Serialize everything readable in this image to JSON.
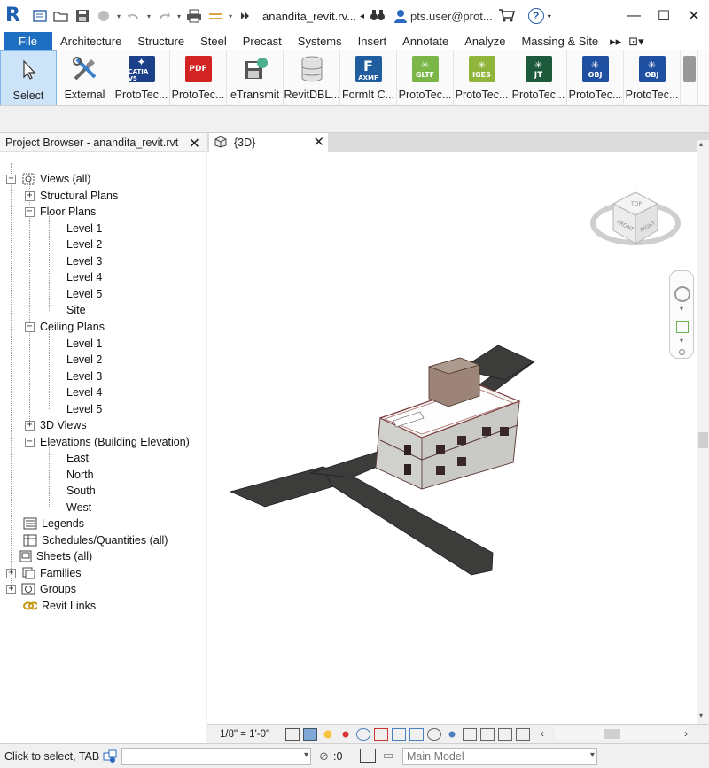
{
  "app": {
    "document_title": "anandita_revit.rv...",
    "user": "pts.user@prot...",
    "help_symbol": "?"
  },
  "menu_tabs": [
    "File",
    "Architecture",
    "Structure",
    "Steel",
    "Precast",
    "Systems",
    "Insert",
    "Annotate",
    "Analyze",
    "Massing & Site"
  ],
  "ribbon": [
    {
      "label": "Select",
      "icon": "cursor-icon"
    },
    {
      "label": "External",
      "icon": "tools-icon"
    },
    {
      "label": "ProtoTec...",
      "icon": "catia-icon",
      "badge": "CATIA V5",
      "color": "#1c3f8a"
    },
    {
      "label": "ProtoTec...",
      "icon": "pdf-icon",
      "badge": "PDF",
      "color": "#d32424"
    },
    {
      "label": "eTransmit",
      "icon": "etransmit-icon"
    },
    {
      "label": "RevitDBL...",
      "icon": "database-icon"
    },
    {
      "label": "FormIt C...",
      "icon": "formit-icon",
      "badge": "AXMF",
      "color": "#1f5d9e"
    },
    {
      "label": "ProtoTec...",
      "icon": "gltf-icon",
      "badge": "GLTF",
      "color": "#7ab648"
    },
    {
      "label": "ProtoTec...",
      "icon": "iges-icon",
      "badge": "IGES",
      "color": "#8fb63a"
    },
    {
      "label": "ProtoTec...",
      "icon": "jt-icon",
      "badge": "JT",
      "color": "#1d5a3c"
    },
    {
      "label": "ProtoTec...",
      "icon": "obj-icon",
      "badge": "OBJ",
      "color": "#1f4fa0"
    },
    {
      "label": "ProtoTec...",
      "icon": "obj-icon",
      "badge": "OBJ",
      "color": "#1f4fa0"
    }
  ],
  "project_browser": {
    "title": "Project Browser - anandita_revit.rvt",
    "nodes": [
      {
        "label": "Views (all)"
      },
      {
        "label": "Structural Plans"
      },
      {
        "label": "Floor Plans"
      },
      {
        "label": "Level 1"
      },
      {
        "label": "Level 2"
      },
      {
        "label": "Level 3"
      },
      {
        "label": "Level 4"
      },
      {
        "label": "Level 5"
      },
      {
        "label": "Site"
      },
      {
        "label": "Ceiling Plans"
      },
      {
        "label": "Level 1"
      },
      {
        "label": "Level 2"
      },
      {
        "label": "Level 3"
      },
      {
        "label": "Level 4"
      },
      {
        "label": "Level 5"
      },
      {
        "label": "3D Views"
      },
      {
        "label": "Elevations (Building Elevation)"
      },
      {
        "label": "East"
      },
      {
        "label": "North"
      },
      {
        "label": "South"
      },
      {
        "label": "West"
      },
      {
        "label": "Legends"
      },
      {
        "label": "Schedules/Quantities (all)"
      },
      {
        "label": "Sheets (all)"
      },
      {
        "label": "Families"
      },
      {
        "label": "Groups"
      },
      {
        "label": "Revit Links"
      }
    ]
  },
  "view_tab": {
    "label": "{3D}"
  },
  "view_cube": {
    "top": "TOP",
    "front": "FRONT",
    "right": "RIGHT"
  },
  "view_control": {
    "scale": "1/8\" = 1'-0\""
  },
  "status": {
    "text": "Click to select, TAB",
    "filter_count": ":0",
    "model": "Main Model"
  }
}
